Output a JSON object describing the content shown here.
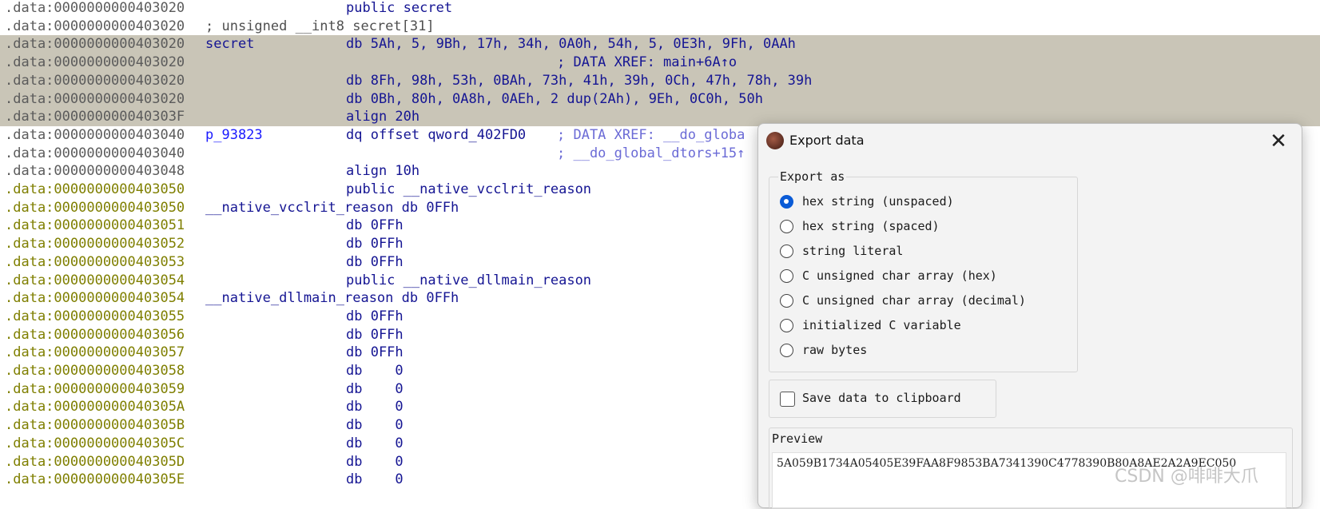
{
  "listing": [
    {
      "addr": ".data:0000000000403020",
      "addr_color": "gray",
      "label": "",
      "body": "public secret",
      "body_color": "navy",
      "comment": "",
      "hl": false
    },
    {
      "addr": ".data:0000000000403020",
      "addr_color": "gray",
      "label": "; unsigned __int8 secret[31]",
      "label_color": "gray",
      "body": "",
      "comment": "",
      "hl": false
    },
    {
      "addr": ".data:0000000000403020",
      "addr_color": "gray",
      "label": "secret",
      "label_color": "navy",
      "body": "db 5Ah, 5, 9Bh, 17h, 34h, 0A0h, 54h, 5, 0E3h, 9Fh, 0AAh",
      "body_color": "navy",
      "comment": "",
      "hl": true
    },
    {
      "addr": ".data:0000000000403020",
      "addr_color": "gray",
      "label": "",
      "body": "",
      "comment": "; DATA XREF: main+6A↑o",
      "comment_color": "navy",
      "hl": true
    },
    {
      "addr": ".data:0000000000403020",
      "addr_color": "gray",
      "label": "",
      "body": "db 8Fh, 98h, 53h, 0BAh, 73h, 41h, 39h, 0Ch, 47h, 78h, 39h",
      "body_color": "navy",
      "comment": "",
      "hl": true
    },
    {
      "addr": ".data:0000000000403020",
      "addr_color": "gray",
      "label": "",
      "body": "db 0Bh, 80h, 0A8h, 0AEh, 2 dup(2Ah), 9Eh, 0C0h, 50h",
      "body_color": "navy",
      "comment": "",
      "hl": true
    },
    {
      "addr": ".data:000000000040303F",
      "addr_color": "gray",
      "label": "",
      "body": "align 20h",
      "body_color": "navy",
      "comment": "",
      "hl": true
    },
    {
      "addr": ".data:0000000000403040",
      "addr_color": "gray",
      "label": "p_93823",
      "label_color": "blue",
      "body": "dq offset qword_402FD0",
      "body_color": "navy",
      "comment": "; DATA XREF: __do_globa",
      "comment_color": "cmtblue",
      "hl": false
    },
    {
      "addr": ".data:0000000000403040",
      "addr_color": "gray",
      "label": "",
      "body": "",
      "comment": "; __do_global_dtors+15↑",
      "comment_color": "cmtblue",
      "hl": false
    },
    {
      "addr": ".data:0000000000403048",
      "addr_color": "gray",
      "label": "",
      "body": "align 10h",
      "body_color": "navy",
      "comment": "",
      "hl": false
    },
    {
      "addr": ".data:0000000000403050",
      "addr_color": "olive",
      "label": "",
      "body": "public __native_vcclrit_reason",
      "body_color": "navy",
      "comment": "",
      "hl": false
    },
    {
      "addr": ".data:0000000000403050",
      "addr_color": "olive",
      "label": "__native_vcclrit_reason db 0FFh",
      "label_color": "navy",
      "body": "",
      "comment": "",
      "hl": false
    },
    {
      "addr": ".data:0000000000403051",
      "addr_color": "olive",
      "label": "",
      "body": "db 0FFh",
      "body_color": "navy",
      "comment": "",
      "hl": false
    },
    {
      "addr": ".data:0000000000403052",
      "addr_color": "olive",
      "label": "",
      "body": "db 0FFh",
      "body_color": "navy",
      "comment": "",
      "hl": false
    },
    {
      "addr": ".data:0000000000403053",
      "addr_color": "olive",
      "label": "",
      "body": "db 0FFh",
      "body_color": "navy",
      "comment": "",
      "hl": false
    },
    {
      "addr": ".data:0000000000403054",
      "addr_color": "olive",
      "label": "",
      "body": "public __native_dllmain_reason",
      "body_color": "navy",
      "comment": "",
      "hl": false
    },
    {
      "addr": ".data:0000000000403054",
      "addr_color": "olive",
      "label": "__native_dllmain_reason db 0FFh",
      "label_color": "navy",
      "body": "",
      "comment": "",
      "hl": false
    },
    {
      "addr": ".data:0000000000403055",
      "addr_color": "olive",
      "label": "",
      "body": "db 0FFh",
      "body_color": "navy",
      "comment": "",
      "hl": false
    },
    {
      "addr": ".data:0000000000403056",
      "addr_color": "olive",
      "label": "",
      "body": "db 0FFh",
      "body_color": "navy",
      "comment": "",
      "hl": false
    },
    {
      "addr": ".data:0000000000403057",
      "addr_color": "olive",
      "label": "",
      "body": "db 0FFh",
      "body_color": "navy",
      "comment": "",
      "hl": false
    },
    {
      "addr": ".data:0000000000403058",
      "addr_color": "olive",
      "label": "",
      "body": "db    0",
      "body_color": "navy",
      "comment": "",
      "hl": false
    },
    {
      "addr": ".data:0000000000403059",
      "addr_color": "olive",
      "label": "",
      "body": "db    0",
      "body_color": "navy",
      "comment": "",
      "hl": false
    },
    {
      "addr": ".data:000000000040305A",
      "addr_color": "olive",
      "label": "",
      "body": "db    0",
      "body_color": "navy",
      "comment": "",
      "hl": false
    },
    {
      "addr": ".data:000000000040305B",
      "addr_color": "olive",
      "label": "",
      "body": "db    0",
      "body_color": "navy",
      "comment": "",
      "hl": false
    },
    {
      "addr": ".data:000000000040305C",
      "addr_color": "olive",
      "label": "",
      "body": "db    0",
      "body_color": "navy",
      "comment": "",
      "hl": false
    },
    {
      "addr": ".data:000000000040305D",
      "addr_color": "olive",
      "label": "",
      "body": "db    0",
      "body_color": "navy",
      "comment": "",
      "hl": false
    },
    {
      "addr": ".data:000000000040305E",
      "addr_color": "olive",
      "label": "",
      "body": "db    0",
      "body_color": "navy",
      "comment": "",
      "hl": false
    }
  ],
  "dialog": {
    "title": "Export data",
    "close_glyph": "✕",
    "icon": "app-avatar-icon",
    "export_as_label": "Export as",
    "options": [
      {
        "label": "hex string (unspaced)",
        "selected": true
      },
      {
        "label": "hex string (spaced)",
        "selected": false
      },
      {
        "label": "string literal",
        "selected": false
      },
      {
        "label": "C unsigned char array (hex)",
        "selected": false
      },
      {
        "label": "C unsigned char array (decimal)",
        "selected": false
      },
      {
        "label": "initialized C variable",
        "selected": false
      },
      {
        "label": "raw bytes",
        "selected": false
      }
    ],
    "save_to_clipboard_label": "Save data to clipboard",
    "save_to_clipboard_checked": false,
    "preview_label": "Preview",
    "preview_value": "5A059B1734A05405E39FAA8F9853BA7341390C4778390B80A8AE2A2A9EC050"
  },
  "watermark": "CSDN @啡啡大爪",
  "colors": {
    "gray": "#5b5b5b",
    "olive": "#7f7f00",
    "navy": "#151593",
    "blue": "#1a1aff",
    "cmtblue": "#6b6bd6",
    "highlight": "#c9c5b7",
    "radio_on": "#0a5bd6"
  }
}
